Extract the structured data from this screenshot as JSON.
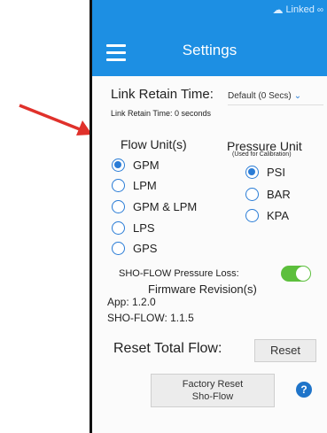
{
  "status": {
    "linked_label": "Linked",
    "cloud_icon": "cloud-icon",
    "link_icon": "link-icon"
  },
  "header": {
    "title": "Settings",
    "accent": "#1d8fe3"
  },
  "link_retain": {
    "label": "Link Retain Time:",
    "selected": "Default (0 Secs)",
    "note": "Link Retain Time: 0 seconds"
  },
  "flow_unit": {
    "title": "Flow Unit(s)",
    "options": [
      "GPM",
      "LPM",
      "GPM & LPM",
      "LPS",
      "GPS"
    ],
    "selected": "GPM"
  },
  "pressure_unit": {
    "title": "Pressure Unit",
    "subtitle": "(Used for Calibration)",
    "options": [
      "PSI",
      "BAR",
      "KPA"
    ],
    "selected": "PSI"
  },
  "pressure_loss": {
    "label": "SHO-FLOW Pressure Loss:",
    "enabled": true
  },
  "firmware": {
    "title": "Firmware Revision(s)",
    "app_line": "App: 1.2.0",
    "device_line": "SHO-FLOW: 1.1.5"
  },
  "reset_total": {
    "label": "Reset Total Flow:",
    "button": "Reset"
  },
  "factory_reset": {
    "line1": "Factory Reset",
    "line2": "Sho-Flow"
  },
  "help_glyph": "?"
}
